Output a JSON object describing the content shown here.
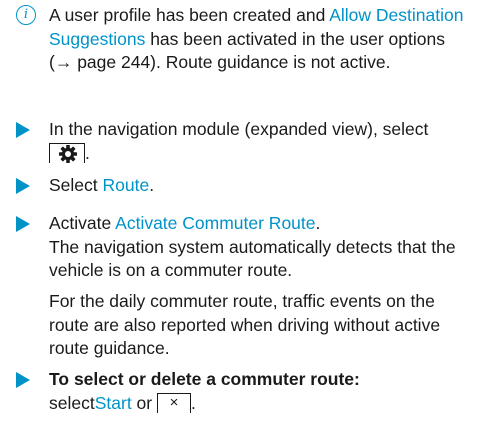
{
  "info": {
    "icon": "info-icon",
    "part1": "A user profile has been created and ",
    "link": "Allow Destination Suggestions",
    "part2": " has been activated in the user options (→ page 244). Route guidance is not active."
  },
  "step1": {
    "icon": "arrow-icon",
    "text": "In the navigation module (expanded view), select ",
    "button_icon": "gear-icon",
    "end": "."
  },
  "step2": {
    "icon": "arrow-icon",
    "prefix": "Select ",
    "link": "Route",
    "end": "."
  },
  "step3": {
    "icon": "arrow-icon",
    "prefix": "Activate ",
    "link": "Activate Commuter Route",
    "end": ".",
    "result": "The navigation system automatically detects that the vehicle is on a commuter route."
  },
  "note": {
    "text": "For the daily commuter route, traffic events on the route are also reported when driving without active route guidance."
  },
  "step4": {
    "icon": "arrow-icon",
    "heading": "To select or delete a commuter route:",
    "prefix": "select",
    "link": "Start",
    "middle": " or ",
    "close_symbol": "×",
    "end": "."
  },
  "colors": {
    "accent": "#0093c8",
    "text": "#1a1a1a"
  }
}
